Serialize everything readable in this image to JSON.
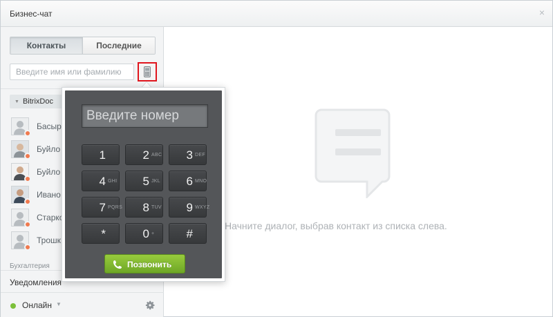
{
  "window": {
    "title": "Бизнес-чат",
    "close_glyph": "×"
  },
  "sidebar": {
    "tabs": [
      {
        "label": "Контакты",
        "active": true
      },
      {
        "label": "Последние",
        "active": false
      }
    ],
    "search": {
      "placeholder": "Введите имя или фамилию",
      "value": ""
    },
    "group": {
      "label": "BitrixDoc",
      "expanded": true
    },
    "contacts": [
      {
        "name": "Басыр",
        "status": "away"
      },
      {
        "name": "Буйло",
        "status": "away"
      },
      {
        "name": "Буйло",
        "status": "away"
      },
      {
        "name": "Ивано",
        "status": "away"
      },
      {
        "name": "Старко",
        "status": "away"
      },
      {
        "name": "Трошк",
        "status": "away"
      }
    ],
    "group2_label": "Бухгалтерия",
    "notifications_label": "Уведомления",
    "status": {
      "label": "Онлайн",
      "color": "#7cc03a"
    }
  },
  "main": {
    "empty_text": "Начните диалог, выбрав контакт из списка слева."
  },
  "dialer": {
    "input_placeholder": "Введите номер",
    "keys": [
      {
        "digit": "1",
        "letters": ""
      },
      {
        "digit": "2",
        "letters": "ABC"
      },
      {
        "digit": "3",
        "letters": "DEF"
      },
      {
        "digit": "4",
        "letters": "GHI"
      },
      {
        "digit": "5",
        "letters": "JKL"
      },
      {
        "digit": "6",
        "letters": "MNO"
      },
      {
        "digit": "7",
        "letters": "PQRS"
      },
      {
        "digit": "8",
        "letters": "TUV"
      },
      {
        "digit": "9",
        "letters": "WXYZ"
      },
      {
        "digit": "*",
        "letters": ""
      },
      {
        "digit": "0",
        "letters": "+"
      },
      {
        "digit": "#",
        "letters": ""
      }
    ],
    "call_label": "Позвонить",
    "call_color": "#8bc34a"
  },
  "colors": {
    "highlight_border": "#e0151d",
    "away_status": "#f07a4f"
  }
}
